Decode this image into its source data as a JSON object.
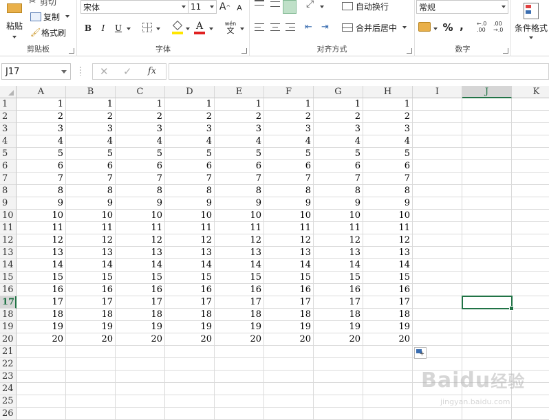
{
  "ribbon": {
    "clipboard": {
      "cut": "剪切",
      "copy": "复制",
      "format_painter": "格式刷",
      "paste": "粘贴",
      "group_label": "剪贴板"
    },
    "font": {
      "font_name": "宋体",
      "font_size": "11",
      "bold": "B",
      "italic": "I",
      "underline": "U",
      "grow": "A",
      "shrink": "A",
      "phonetic_top": "wén",
      "phonetic_bottom": "文",
      "group_label": "字体"
    },
    "alignment": {
      "wrap_text": "自动换行",
      "merge_center": "合并后居中",
      "group_label": "对齐方式"
    },
    "number": {
      "format": "常规",
      "percent": "%",
      "comma": ",",
      "inc_decimal": "←.0\n.00",
      "dec_decimal": ".00\n→.0",
      "group_label": "数字"
    },
    "styles": {
      "conditional_format": "条件格式"
    }
  },
  "formula_bar": {
    "name_box": "J17",
    "fx": "fx",
    "cancel": "✕",
    "enter": "✓",
    "formula": ""
  },
  "sheet": {
    "columns": [
      "A",
      "B",
      "C",
      "D",
      "E",
      "F",
      "G",
      "H",
      "I",
      "J",
      "K"
    ],
    "active_column": "J",
    "active_row": 17,
    "rows": [
      {
        "n": "1",
        "v": [
          "1",
          "1",
          "1",
          "1",
          "1",
          "1",
          "1",
          "1"
        ]
      },
      {
        "n": "2",
        "v": [
          "2",
          "2",
          "2",
          "2",
          "2",
          "2",
          "2",
          "2"
        ]
      },
      {
        "n": "3",
        "v": [
          "3",
          "3",
          "3",
          "3",
          "3",
          "3",
          "3",
          "3"
        ]
      },
      {
        "n": "4",
        "v": [
          "4",
          "4",
          "4",
          "4",
          "4",
          "4",
          "4",
          "4"
        ]
      },
      {
        "n": "5",
        "v": [
          "5",
          "5",
          "5",
          "5",
          "5",
          "5",
          "5",
          "5"
        ]
      },
      {
        "n": "6",
        "v": [
          "6",
          "6",
          "6",
          "6",
          "6",
          "6",
          "6",
          "6"
        ]
      },
      {
        "n": "7",
        "v": [
          "7",
          "7",
          "7",
          "7",
          "7",
          "7",
          "7",
          "7"
        ]
      },
      {
        "n": "8",
        "v": [
          "8",
          "8",
          "8",
          "8",
          "8",
          "8",
          "8",
          "8"
        ]
      },
      {
        "n": "9",
        "v": [
          "9",
          "9",
          "9",
          "9",
          "9",
          "9",
          "9",
          "9"
        ]
      },
      {
        "n": "10",
        "v": [
          "10",
          "10",
          "10",
          "10",
          "10",
          "10",
          "10",
          "10"
        ]
      },
      {
        "n": "11",
        "v": [
          "11",
          "11",
          "11",
          "11",
          "11",
          "11",
          "11",
          "11"
        ]
      },
      {
        "n": "12",
        "v": [
          "12",
          "12",
          "12",
          "12",
          "12",
          "12",
          "12",
          "12"
        ]
      },
      {
        "n": "13",
        "v": [
          "13",
          "13",
          "13",
          "13",
          "13",
          "13",
          "13",
          "13"
        ]
      },
      {
        "n": "14",
        "v": [
          "14",
          "14",
          "14",
          "14",
          "14",
          "14",
          "14",
          "14"
        ]
      },
      {
        "n": "15",
        "v": [
          "15",
          "15",
          "15",
          "15",
          "15",
          "15",
          "15",
          "15"
        ]
      },
      {
        "n": "16",
        "v": [
          "16",
          "16",
          "16",
          "16",
          "16",
          "16",
          "16",
          "16"
        ]
      },
      {
        "n": "17",
        "v": [
          "17",
          "17",
          "17",
          "17",
          "17",
          "17",
          "17",
          "17"
        ]
      },
      {
        "n": "18",
        "v": [
          "18",
          "18",
          "18",
          "18",
          "18",
          "18",
          "18",
          "18"
        ]
      },
      {
        "n": "19",
        "v": [
          "19",
          "19",
          "19",
          "19",
          "19",
          "19",
          "19",
          "19"
        ]
      },
      {
        "n": "20",
        "v": [
          "20",
          "20",
          "20",
          "20",
          "20",
          "20",
          "20",
          "20"
        ]
      },
      {
        "n": "21",
        "v": []
      },
      {
        "n": "22",
        "v": []
      },
      {
        "n": "23",
        "v": []
      },
      {
        "n": "24",
        "v": []
      },
      {
        "n": "25",
        "v": []
      },
      {
        "n": "26",
        "v": []
      }
    ]
  },
  "watermark": {
    "brand": "Baidu",
    "brand_cn": "经验",
    "url": "jingyan.baidu.com"
  },
  "colors": {
    "accent": "#217346",
    "font_color": "#e02020",
    "highlight": "#ffe600"
  }
}
